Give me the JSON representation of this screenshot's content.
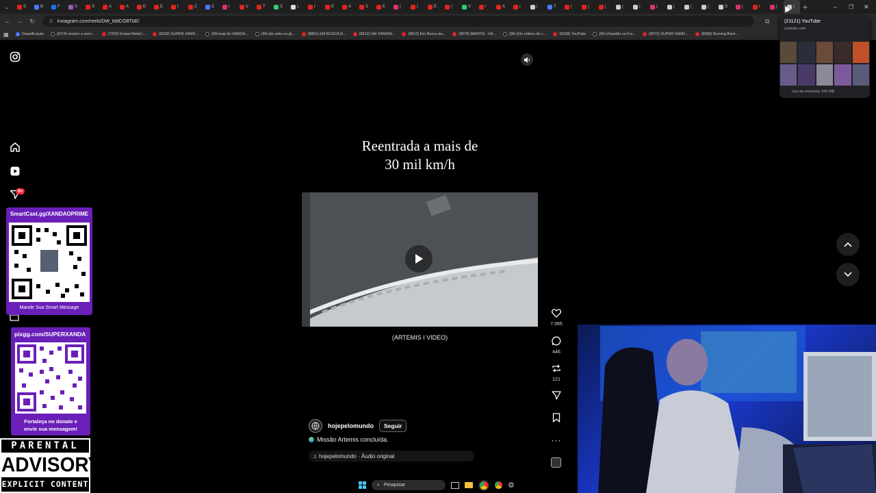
{
  "browser": {
    "tabs": [
      {
        "color": "#e02424",
        "t": "S"
      },
      {
        "color": "#4a7bff",
        "t": "B"
      },
      {
        "color": "#1a73e8",
        "t": "F"
      },
      {
        "color": "#9b59b6",
        "t": "S"
      },
      {
        "color": "#e02424",
        "t": "S"
      },
      {
        "color": "#e02424",
        "t": "A"
      },
      {
        "color": "#e02424",
        "t": "A"
      },
      {
        "color": "#e02424",
        "t": "E"
      },
      {
        "color": "#e02424",
        "t": "E"
      },
      {
        "color": "#e02424",
        "t": "I"
      },
      {
        "color": "#e02424",
        "t": "C"
      },
      {
        "color": "#4a7bff",
        "t": "C"
      },
      {
        "color": "#e1306c",
        "t": "I"
      },
      {
        "color": "#e02424",
        "t": "V"
      },
      {
        "color": "#e02424",
        "t": "T"
      },
      {
        "color": "#2ecc71",
        "t": "S"
      },
      {
        "color": "#dddddd",
        "t": "L"
      },
      {
        "color": "#e02424",
        "t": "I"
      },
      {
        "color": "#e02424",
        "t": "E"
      },
      {
        "color": "#e02424",
        "t": "A"
      },
      {
        "color": "#e02424",
        "t": "S"
      },
      {
        "color": "#e02424",
        "t": "E"
      },
      {
        "color": "#e1306c",
        "t": "("
      },
      {
        "color": "#e02424",
        "t": "("
      },
      {
        "color": "#e02424",
        "t": "E"
      },
      {
        "color": "#e02424",
        "t": "("
      },
      {
        "color": "#2ecc71",
        "t": "V"
      },
      {
        "color": "#e02424",
        "t": "/"
      },
      {
        "color": "#e02424",
        "t": "A"
      },
      {
        "color": "#e02424",
        "t": "("
      },
      {
        "color": "#cccccc",
        "t": "("
      },
      {
        "color": "#4a7bff",
        "t": "T"
      },
      {
        "color": "#e02424",
        "t": "("
      },
      {
        "color": "#e02424",
        "t": "("
      },
      {
        "color": "#e02424",
        "t": "("
      },
      {
        "color": "#cccccc",
        "t": "("
      },
      {
        "color": "#cccccc",
        "t": "("
      },
      {
        "color": "#e1306c",
        "t": "("
      },
      {
        "color": "#cccccc",
        "t": "("
      },
      {
        "color": "#cccccc",
        "t": "("
      },
      {
        "color": "#cccccc",
        "t": "("
      },
      {
        "color": "#cccccc",
        "t": "S"
      },
      {
        "color": "#e1306c",
        "t": "("
      },
      {
        "color": "#e02424",
        "t": "I"
      },
      {
        "color": "#e1306c",
        "t": "("
      },
      {
        "color": "#cccccc",
        "t": "("
      }
    ],
    "url": "instagram.com/reels/DW_MdCGBTbE/",
    "bookmarks": [
      {
        "label": "Classificação",
        "kind": "g"
      },
      {
        "label": "(97)Te ensino a venc...",
        "kind": "t"
      },
      {
        "label": "(7292) Enéas Metal |...",
        "kind": "y"
      },
      {
        "label": "(8159) SUPER XAND...",
        "kind": "y"
      },
      {
        "label": "(99+)rap do XANDÃ...",
        "kind": "t"
      },
      {
        "label": "(99+)tá cedo ou já...",
        "kind": "t"
      },
      {
        "label": "(8851) EM BUSCA D...",
        "kind": "y"
      },
      {
        "label": "(8912) VAI XANDIN...",
        "kind": "y"
      },
      {
        "label": "(8912) Em Busca da...",
        "kind": "y"
      },
      {
        "label": "(9078) MANTIS - XA...",
        "kind": "y"
      },
      {
        "label": "(99+)Os vídeos de c...",
        "kind": "t"
      },
      {
        "label": "(9338) YouTube",
        "kind": "y"
      },
      {
        "label": "(99+)Xandão vs Fra...",
        "kind": "t"
      },
      {
        "label": "(9572) SUPER XAND...",
        "kind": "y"
      },
      {
        "label": "(9580) Burning Bord...",
        "kind": "y"
      }
    ],
    "popup": {
      "title": "(21121) YouTube",
      "domain": "youtube.com",
      "memory": "Uso da memória: 540 MB"
    }
  },
  "reel": {
    "title_line1": "Reentrada a mais de",
    "title_line2": "30 mil km/h",
    "video_caption": "(ARTEMIS I VIDEO)",
    "username": "hojepelomundo",
    "follow_label": "Seguir",
    "description": "Missão Artemis concluída.",
    "audio": "hojepelomundo · Áudio original"
  },
  "actions": {
    "likes": "7.065",
    "comments": "446",
    "reposts": "121"
  },
  "sidebar": {
    "notification_badge": "9+"
  },
  "overlays": {
    "qr1_header": "SmartCast.gg/XANDAOPRIME",
    "qr1_footer": "Mande Sua Smart Message",
    "qr2_header": "pixgg.com/SUPERXANDA",
    "qr2_footer_line1": "Fortaleça no donate e",
    "qr2_footer_line2": "envie sua mensagem!",
    "advisory_top": "PARENTAL",
    "advisory_mid": "ADVISORY",
    "advisory_bot": "EXPLICIT CONTENT"
  },
  "taskbar": {
    "search_placeholder": "Pesquisar"
  },
  "colors": {
    "accent": "#e1306c",
    "qr_bg": "#6a1fb8",
    "youtube": "#e02424"
  }
}
